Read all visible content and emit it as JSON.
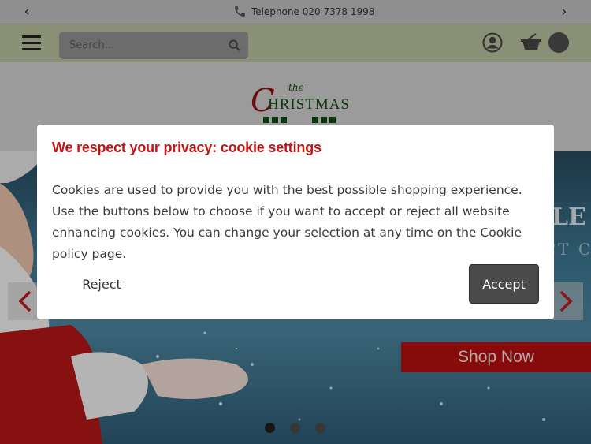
{
  "topbar": {
    "prev_icon": "chevron-left-icon",
    "next_icon": "chevron-right-icon",
    "phone_icon": "phone-icon",
    "telephone_text": "Telephone 020 7378 1998"
  },
  "header": {
    "menu_icon": "hamburger-icon",
    "search": {
      "placeholder": "Search...",
      "value": "",
      "icon": "search-icon"
    },
    "account_icon": "user-icon",
    "basket_icon": "basket-icon"
  },
  "logo": {
    "the": "the",
    "word_initial": "C",
    "word_rest": "HRISTMAS",
    "shop": "shop"
  },
  "banner": {
    "shop_now_label": "Shop Now",
    "text_line1": "LE",
    "text_line2": "CT C",
    "slides_total": 3,
    "active_slide": 1
  },
  "cookie_modal": {
    "title": "We respect your privacy: cookie settings",
    "body": "Cookies are used to provide you with the best possible shopping experience. Use the buttons below to choose if you want to accept or reject all website enhancing cookies. You can change your selection at any time on the Cookie policy page.",
    "reject_label": "Reject",
    "accept_label": "Accept"
  },
  "colors": {
    "accent_red": "#c41414",
    "header_bar": "#b8c09d",
    "accept_button": "#4a4a4a"
  }
}
